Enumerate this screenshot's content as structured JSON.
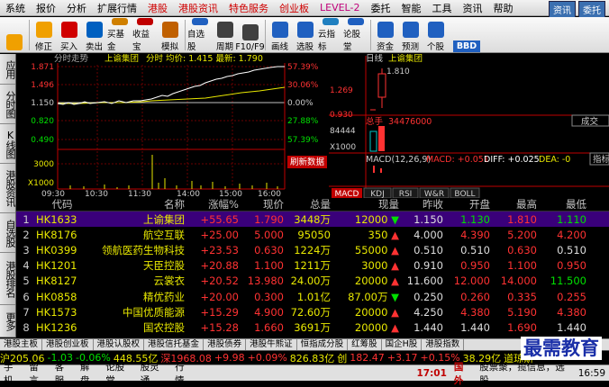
{
  "menu": {
    "items": [
      "系统",
      "报价",
      "分析",
      "扩展行情",
      "港股",
      "港股资讯",
      "特色服务",
      "创业板",
      "LEVEL-2",
      "委托",
      "智能",
      "工具",
      "资讯",
      "帮助"
    ],
    "right_labels": [
      "资讯",
      "委托"
    ]
  },
  "toolbar": {
    "buttons": [
      {
        "label": "",
        "icon": "back-arrow-icon",
        "color": "#f0a000"
      },
      {
        "label": "修正",
        "icon": "up-down-arrow-icon",
        "color": "#f0a000"
      },
      {
        "label": "买入",
        "icon": "buy-icon",
        "color": "#d00000"
      },
      {
        "label": "卖出",
        "icon": "sell-icon",
        "color": "#0060c0"
      },
      {
        "label": "买基金",
        "icon": "fund-icon",
        "color": "#d08000"
      },
      {
        "label": "收益宝",
        "icon": "treasure-icon",
        "color": "#c00000"
      },
      {
        "label": "模拟",
        "icon": "simulate-icon",
        "color": "#c06000"
      },
      {
        "label": "自选股",
        "icon": "favorite-stock-icon",
        "color": "#2060c0"
      },
      {
        "label": "周期",
        "icon": "period-icon",
        "color": "#404040"
      },
      {
        "label": "F10/F9",
        "icon": "f10-icon",
        "color": "#404040"
      },
      {
        "label": "画线",
        "icon": "draw-line-icon",
        "color": "#2060c0"
      },
      {
        "label": "选股",
        "icon": "select-stock-icon",
        "color": "#2060c0"
      },
      {
        "label": "云指标",
        "icon": "cloud-indicator-icon",
        "color": "#2080c0"
      },
      {
        "label": "论股堂",
        "icon": "forum-icon",
        "color": "#2060c0"
      },
      {
        "label": "资金",
        "icon": "capital-icon",
        "color": "#2060c0"
      },
      {
        "label": "预测",
        "icon": "forecast-icon",
        "color": "#2060c0"
      },
      {
        "label": "个股",
        "icon": "stock-icon",
        "color": "#2060c0"
      }
    ],
    "bbd": "BBD"
  },
  "leftnav": {
    "items": [
      "应用",
      "分时图",
      "K线图",
      "港股资讯",
      "自选股",
      "港股排名",
      "更多"
    ]
  },
  "intraday": {
    "title": "分时走势",
    "stock": "上谕集团",
    "subtitle": "分时 均价: 1.415 最新: 1.790",
    "y_left": [
      "1.871",
      "1.496",
      "1.150",
      "0.820",
      "0.490",
      "3000",
      "X1000"
    ],
    "y_right": [
      "57.39%",
      "30.06%",
      "0.00%",
      "27.88%",
      "57.39%"
    ],
    "x_ticks": [
      "09:30",
      "10:30",
      "11:30",
      "14:00",
      "15:00",
      "16:00"
    ],
    "label_refresh": "刷新数据"
  },
  "daily": {
    "title": "日线",
    "stock": "上谕集团",
    "hi": "1.810",
    "y": [
      "1.269",
      "0.930"
    ],
    "vol_label": "总手",
    "vol": "34476000",
    "vol_y": [
      "84444",
      "X1000"
    ],
    "macd": "MACD(12,26,9)",
    "macd_val": "MACD: +0.051",
    "diff": "DIFF: +0.025",
    "dea": "DEA: -0",
    "tabs": [
      "MACD",
      "KDJ",
      "RSI",
      "W&R",
      "BOLL"
    ],
    "side_labels": [
      "成交",
      "指标"
    ]
  },
  "grid": {
    "headers": [
      "",
      "代码",
      "名称",
      "涨幅%",
      "现价",
      "总量",
      "现量",
      "昨收",
      "开盘",
      "最高",
      "最低"
    ],
    "rows": [
      {
        "idx": "1",
        "code": "HK1633",
        "name": "上谕集团",
        "chg": "+55.65",
        "price": "1.790",
        "vol": "3448万",
        "cur": "12000",
        "prev": "1.150",
        "open": "1.130",
        "high": "1.810",
        "low": "1.110",
        "arrow": "dn",
        "open_c": "dn",
        "high_c": "up",
        "low_c": "dn"
      },
      {
        "idx": "2",
        "code": "HK8176",
        "name": "航空互联",
        "chg": "+25.00",
        "price": "5.000",
        "vol": "95050",
        "cur": "350",
        "prev": "4.000",
        "open": "4.390",
        "high": "5.200",
        "low": "4.200",
        "arrow": "up",
        "open_c": "up",
        "high_c": "up",
        "low_c": "up"
      },
      {
        "idx": "3",
        "code": "HK0399",
        "name": "领航医药生物科技",
        "chg": "+23.53",
        "price": "0.630",
        "vol": "1224万",
        "cur": "55000",
        "prev": "0.510",
        "open": "0.510",
        "high": "0.630",
        "low": "0.510",
        "arrow": "up",
        "open_c": "fl",
        "high_c": "up",
        "low_c": "fl"
      },
      {
        "idx": "4",
        "code": "HK1201",
        "name": "天臣控股",
        "chg": "+20.88",
        "price": "1.100",
        "vol": "1211万",
        "cur": "3000",
        "prev": "0.910",
        "open": "0.950",
        "high": "1.100",
        "low": "0.950",
        "arrow": "up",
        "open_c": "up",
        "high_c": "up",
        "low_c": "up"
      },
      {
        "idx": "5",
        "code": "HK8127",
        "name": "云裳衣",
        "chg": "+20.52",
        "price": "13.980",
        "vol": "24.00万",
        "cur": "20000",
        "prev": "11.600",
        "open": "12.000",
        "high": "14.000",
        "low": "11.500",
        "arrow": "up",
        "open_c": "up",
        "high_c": "up",
        "low_c": "dn"
      },
      {
        "idx": "6",
        "code": "HK0858",
        "name": "精优药业",
        "chg": "+20.00",
        "price": "0.300",
        "vol": "1.01亿",
        "cur": "87.00万",
        "prev": "0.250",
        "open": "0.260",
        "high": "0.335",
        "low": "0.255",
        "arrow": "dn",
        "open_c": "up",
        "high_c": "up",
        "low_c": "up"
      },
      {
        "idx": "7",
        "code": "HK1573",
        "name": "中国优质能源",
        "chg": "+15.29",
        "price": "4.900",
        "vol": "72.60万",
        "cur": "20000",
        "prev": "4.250",
        "open": "4.380",
        "high": "5.190",
        "low": "4.380",
        "arrow": "up",
        "open_c": "up",
        "high_c": "up",
        "low_c": "up"
      },
      {
        "idx": "8",
        "code": "HK1236",
        "name": "国农控股",
        "chg": "+15.28",
        "price": "1.660",
        "vol": "3691万",
        "cur": "20000",
        "prev": "1.440",
        "open": "1.440",
        "high": "1.690",
        "low": "1.440",
        "arrow": "up",
        "open_c": "fl",
        "high_c": "up",
        "low_c": "fl"
      }
    ]
  },
  "tabbar": {
    "items": [
      "港股主板",
      "港股创业板",
      "港股认股权",
      "港股信托基金",
      "港股债券",
      "港股牛熊证",
      "恒指成分股",
      "红筹股",
      "国企H股",
      "港股指数"
    ]
  },
  "ticker": [
    {
      "t": "沪205.06",
      "c": "yl"
    },
    {
      "t": "-1.03",
      "c": "dn"
    },
    {
      "t": "-0.06%",
      "c": "dn"
    },
    {
      "t": "448.55亿",
      "c": "yl"
    },
    {
      "t": "深1968.08",
      "c": "up"
    },
    {
      "t": "+9.98",
      "c": "up"
    },
    {
      "t": "+0.09%",
      "c": "up"
    },
    {
      "t": "826.83亿",
      "c": "yl"
    },
    {
      "t": "创",
      "c": "yl"
    },
    {
      "t": "182.47",
      "c": "up"
    },
    {
      "t": "+3.17",
      "c": "up"
    },
    {
      "t": "+0.15%",
      "c": "up"
    },
    {
      "t": "38.29亿",
      "c": "yl"
    },
    {
      "t": "道琼斯",
      "c": "yl"
    }
  ],
  "statusbar": {
    "items": [
      "手机",
      "留言",
      "客服",
      "解盘",
      "论股堂",
      "股灵通",
      "行情"
    ],
    "time": "17:01",
    "market": "国外",
    "news": "股票聚，揽信息，选股",
    "clock": "16:59"
  },
  "watermark": "最需教育",
  "colors": {
    "bg": "#000000",
    "up": "#ff3232",
    "down": "#00e000",
    "selection": "#3a007a",
    "axis": "#c00000"
  }
}
